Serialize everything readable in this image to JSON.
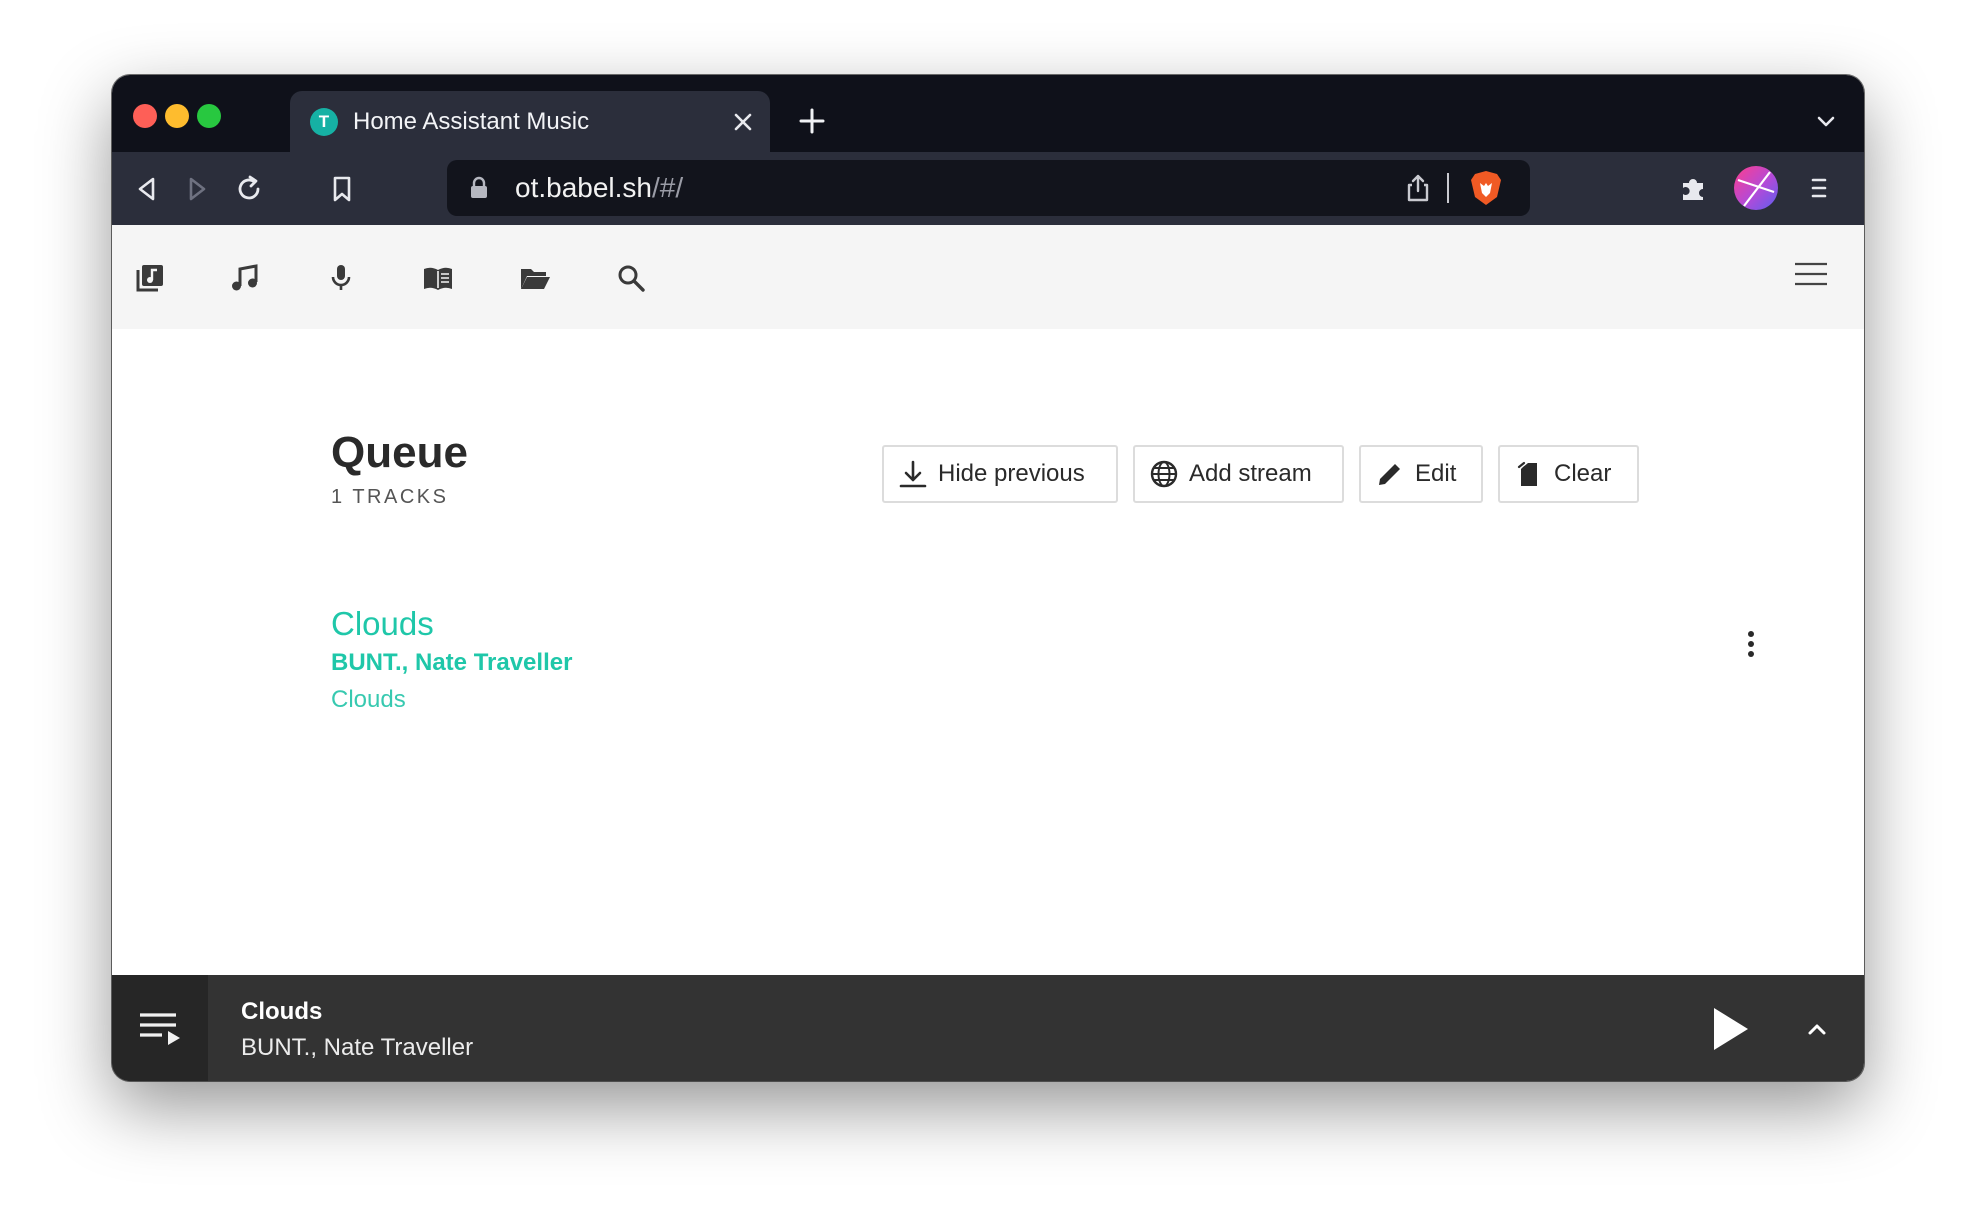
{
  "browser": {
    "tab_title": "Home Assistant Music",
    "tab_favicon_letter": "T",
    "url_host": "ot.babel.sh",
    "url_path": "/#/"
  },
  "app_nav": {
    "items": [
      {
        "icon": "album-library-icon"
      },
      {
        "icon": "music-note-icon"
      },
      {
        "icon": "microphone-icon"
      },
      {
        "icon": "book-open-icon"
      },
      {
        "icon": "folder-open-icon"
      },
      {
        "icon": "search-icon"
      }
    ],
    "menu_icon": "hamburger-menu-icon"
  },
  "queue": {
    "title": "Queue",
    "track_count": "1 TRACKS",
    "buttons": {
      "hide_previous": "Hide previous",
      "add_stream": "Add stream",
      "edit": "Edit",
      "clear": "Clear"
    },
    "tracks": [
      {
        "title": "Clouds",
        "artist": "BUNT., Nate Traveller",
        "album": "Clouds"
      }
    ]
  },
  "player": {
    "title": "Clouds",
    "artist": "BUNT., Nate Traveller"
  },
  "colors": {
    "accent": "#1fc7a9",
    "tab_bar": "#0f111a",
    "toolbar": "#2b2e3b",
    "player_bar": "#333333",
    "brave_orange": "#f05a24"
  }
}
